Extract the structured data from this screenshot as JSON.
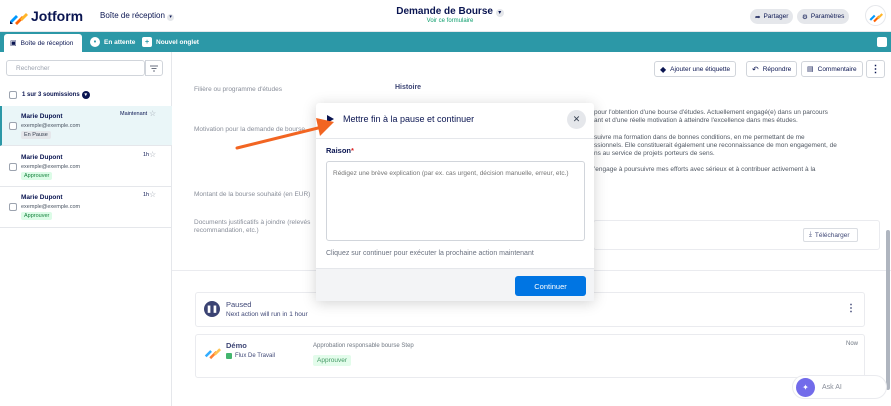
{
  "app": {
    "logo_text": "Jotform",
    "inbox_selector": "Boîte de réception",
    "form_title": "Demande de Bourse",
    "form_link": "Voir ce formulaire",
    "share_label": "Partager",
    "settings_label": "Paramètres"
  },
  "tabs": {
    "inbox": "Boîte de réception",
    "waiting": "En attente",
    "new_tab": "Nouvel onglet"
  },
  "left": {
    "search_placeholder": "Rechercher",
    "count_label": "1 sur 3 soumissions",
    "items": [
      {
        "name": "Marie Dupont",
        "email": "exemple@exemple.com",
        "time": "Maintenant",
        "status": "En Pause"
      },
      {
        "name": "Marie Dupont",
        "email": "exemple@exemple.com",
        "time": "1h",
        "status": "Approuver"
      },
      {
        "name": "Marie Dupont",
        "email": "exemple@exemple.com",
        "time": "1h",
        "status": "Approuver"
      }
    ]
  },
  "toolbar": {
    "add_tag": "Ajouter une étiquette",
    "reply": "Répondre",
    "comment": "Commentaire"
  },
  "fields": {
    "study_label": "Filière ou programme d'études",
    "study_value": "Histoire",
    "motivation_label": "Motivation pour la demande de bourse",
    "motivation_lines": [
      "pour l'obtention d'une bourse d'études. Actuellement engagé(e) dans un parcours",
      "ant et d'une réelle motivation à atteindre l'excellence dans mes études.",
      "suivre ma formation dans de bonnes conditions, en me permettant de me",
      "ssionnels. Elle constituerait également une reconnaissance de mon engagement, de",
      "ns au service de projets porteurs de sens.",
      "'engage à poursuivre mes efforts avec sérieux et à contribuer activement à la"
    ],
    "amount_label": "Montant de la bourse souhaité (en EUR)",
    "docs_label_1": "Documents justificatifs à joindre (relevés",
    "docs_label_2": "recommandation, etc.)",
    "download": "Télécharger"
  },
  "workflow": {
    "paused_title": "Paused",
    "paused_sub": "Next action will run in 1 hour",
    "demo_title": "Démo",
    "demo_sub": "Flux De Travail",
    "step_label": "Approbation responsable bourse Step",
    "step_status": "Approuver",
    "step_time": "Now"
  },
  "askai": {
    "label": "Ask AI"
  },
  "modal": {
    "title": "Mettre fin à la pause et continuer",
    "reason_label": "Raison",
    "required_mark": "*",
    "textarea_placeholder": "Rédigez une brève explication (par ex. cas urgent, décision manuelle, erreur, etc.)",
    "hint": "Cliquez sur continuer pour exécuter la prochaine action maintenant",
    "continue_label": "Continuer"
  },
  "colors": {
    "tabbar": "#2c98a7",
    "primary": "#0075e3",
    "navy": "#0a1551",
    "arrow": "#f26522"
  }
}
